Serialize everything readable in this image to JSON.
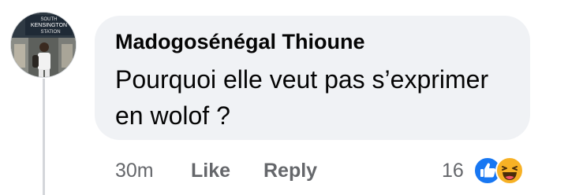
{
  "comment": {
    "avatar": {
      "sign_line1": "SOUTH",
      "sign_line2": "KENSINGTON",
      "sign_line3": "STATION"
    },
    "author": "Madogosénégal Thioune",
    "text": "Pourquoi elle veut pas s’exprimer en wolof ?",
    "timestamp": "30m",
    "like_label": "Like",
    "reply_label": "Reply",
    "reaction_count": "16",
    "reactions": [
      "like-icon",
      "haha-icon"
    ]
  },
  "colors": {
    "bubble": "#f0f2f5",
    "text": "#050505",
    "meta": "#65676b",
    "like_blue": "#1877f2",
    "haha_yellow": "#f7b125"
  }
}
